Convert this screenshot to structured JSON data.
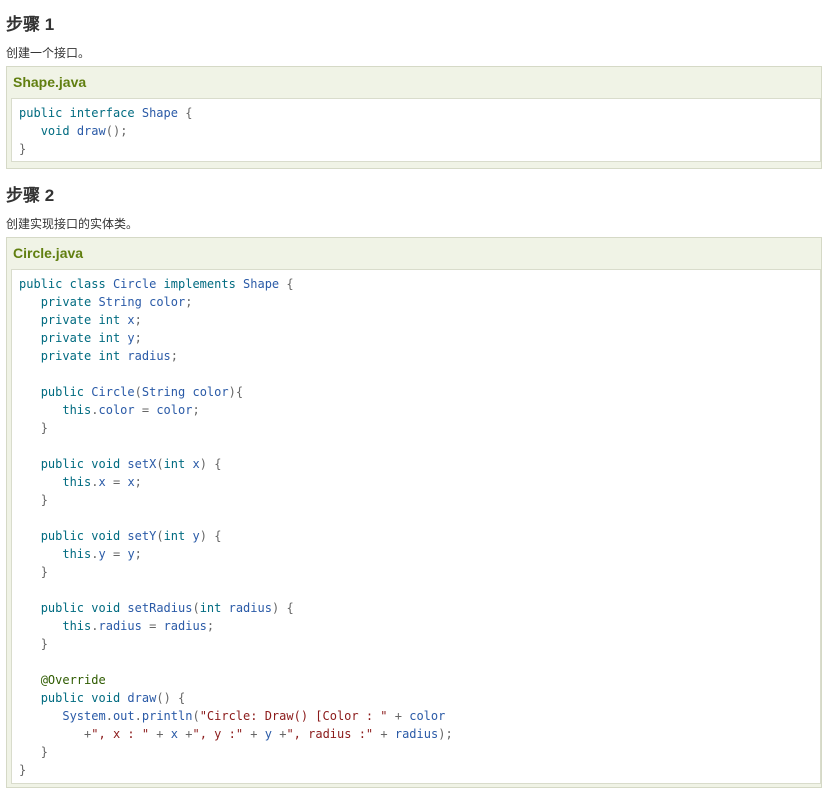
{
  "step1": {
    "title": "步骤 1",
    "description": "创建一个接口。",
    "file_title": "Shape.java",
    "code_lines": [
      "public interface Shape {",
      "   void draw();",
      "}"
    ]
  },
  "step2": {
    "title": "步骤 2",
    "description": "创建实现接口的实体类。",
    "file_title": "Circle.java",
    "code_lines": [
      "public class Circle implements Shape {",
      "   private String color;",
      "   private int x;",
      "   private int y;",
      "   private int radius;",
      "",
      "   public Circle(String color){",
      "      this.color = color;",
      "   }",
      "",
      "   public void setX(int x) {",
      "      this.x = x;",
      "   }",
      "",
      "   public void setY(int y) {",
      "      this.y = y;",
      "   }",
      "",
      "   public void setRadius(int radius) {",
      "      this.radius = radius;",
      "   }",
      "",
      "   @Override",
      "   public void draw() {",
      "      System.out.println(\"Circle: Draw() [Color : \" + color",
      "         +\", x : \" + x +\", y :\" + y +\", radius :\" + radius);",
      "   }",
      "}"
    ]
  }
}
